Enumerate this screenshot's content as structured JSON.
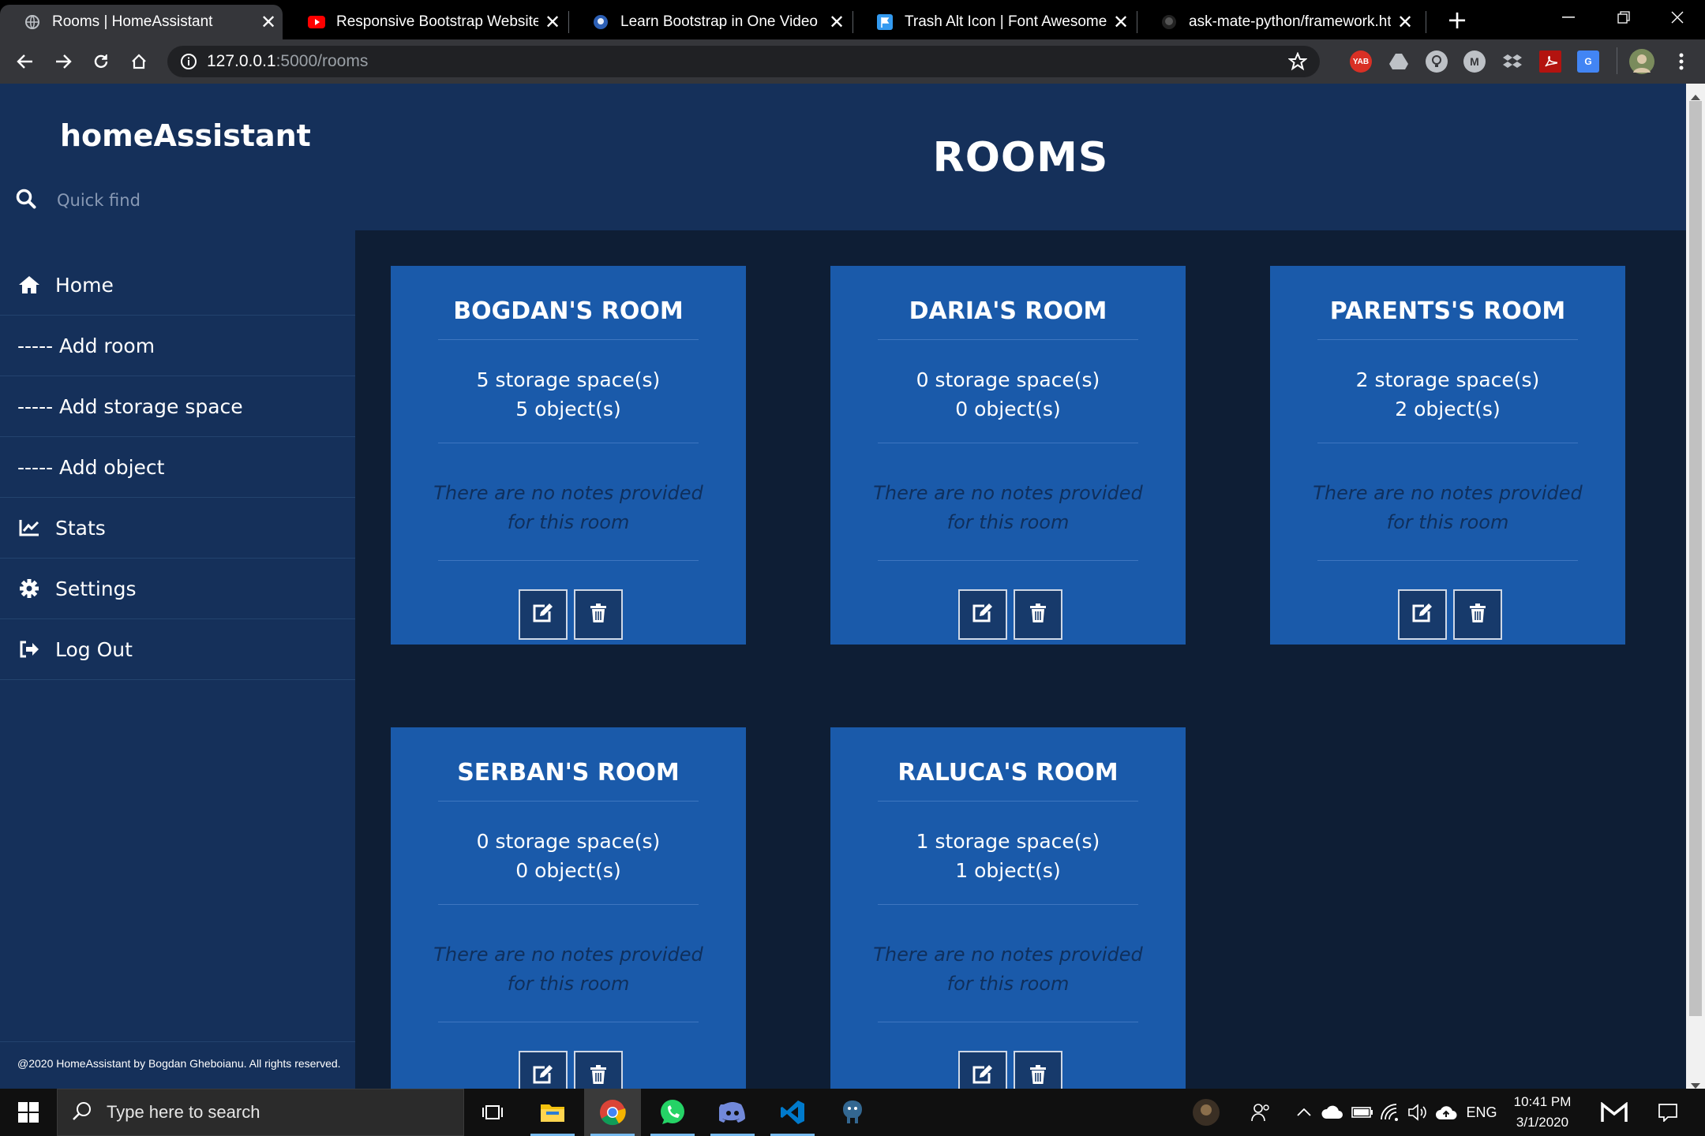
{
  "browser": {
    "tabs": [
      {
        "title": "Rooms | HomeAssistant",
        "favicon": "globe-icon",
        "active": true
      },
      {
        "title": "Responsive Bootstrap Website St",
        "favicon": "youtube-icon",
        "active": false
      },
      {
        "title": "Learn Bootstrap in One Video",
        "favicon": "bird-icon",
        "active": false
      },
      {
        "title": "Trash Alt Icon | Font Awesome",
        "favicon": "flag-icon",
        "active": false
      },
      {
        "title": "ask-mate-python/framework.htm",
        "favicon": "github-icon",
        "active": false
      }
    ],
    "new_tab_label": "+",
    "close_glyph": "✕",
    "url_host": "127.0.0.1",
    "url_path": ":5000/rooms",
    "extensions": [
      "YAB",
      "drive",
      "bulb",
      "M",
      "dropbox",
      "pdf",
      "translate",
      "profile"
    ]
  },
  "sidebar": {
    "brand": "homeAssistant",
    "search_placeholder": "Quick find",
    "nav": [
      {
        "label": "Home",
        "icon": "home-icon"
      },
      {
        "label": "----- Add room",
        "icon": ""
      },
      {
        "label": "----- Add storage space",
        "icon": ""
      },
      {
        "label": "----- Add object",
        "icon": ""
      },
      {
        "label": "Stats",
        "icon": "chart-line-icon"
      },
      {
        "label": "Settings",
        "icon": "gear-icon"
      },
      {
        "label": "Log Out",
        "icon": "sign-out-icon"
      }
    ],
    "footer": "@2020 HomeAssistant by Bogdan Gheboianu. All rights reserved."
  },
  "main": {
    "title": "ROOMS",
    "rooms": [
      {
        "name": "BOGDAN'S ROOM",
        "storage": "5 storage space(s)",
        "objects": "5 object(s)",
        "notes": "There are no notes provided for this room"
      },
      {
        "name": "DARIA'S ROOM",
        "storage": "0 storage space(s)",
        "objects": "0 object(s)",
        "notes": "There are no notes provided for this room"
      },
      {
        "name": "PARENTS'S ROOM",
        "storage": "2 storage space(s)",
        "objects": "2 object(s)",
        "notes": "There are no notes provided for this room"
      },
      {
        "name": "SERBAN'S ROOM",
        "storage": "0 storage space(s)",
        "objects": "0 object(s)",
        "notes": "There are no notes provided for this room"
      },
      {
        "name": "RALUCA'S ROOM",
        "storage": "1 storage space(s)",
        "objects": "1 object(s)",
        "notes": "There are no notes provided for this room"
      }
    ]
  },
  "taskbar": {
    "search_placeholder": "Type here to search",
    "apps": [
      "task-view-icon",
      "file-explorer-icon",
      "chrome-icon",
      "whatsapp-icon",
      "discord-icon",
      "vscode-icon",
      "postgres-icon"
    ],
    "language": "ENG",
    "time": "10:41 PM",
    "date": "3/1/2020"
  },
  "colors": {
    "sidebar_bg": "#15305a",
    "page_bg": "#0e1e35",
    "card_bg": "#1a5aaa",
    "notes_text": "#0f2f5c"
  }
}
